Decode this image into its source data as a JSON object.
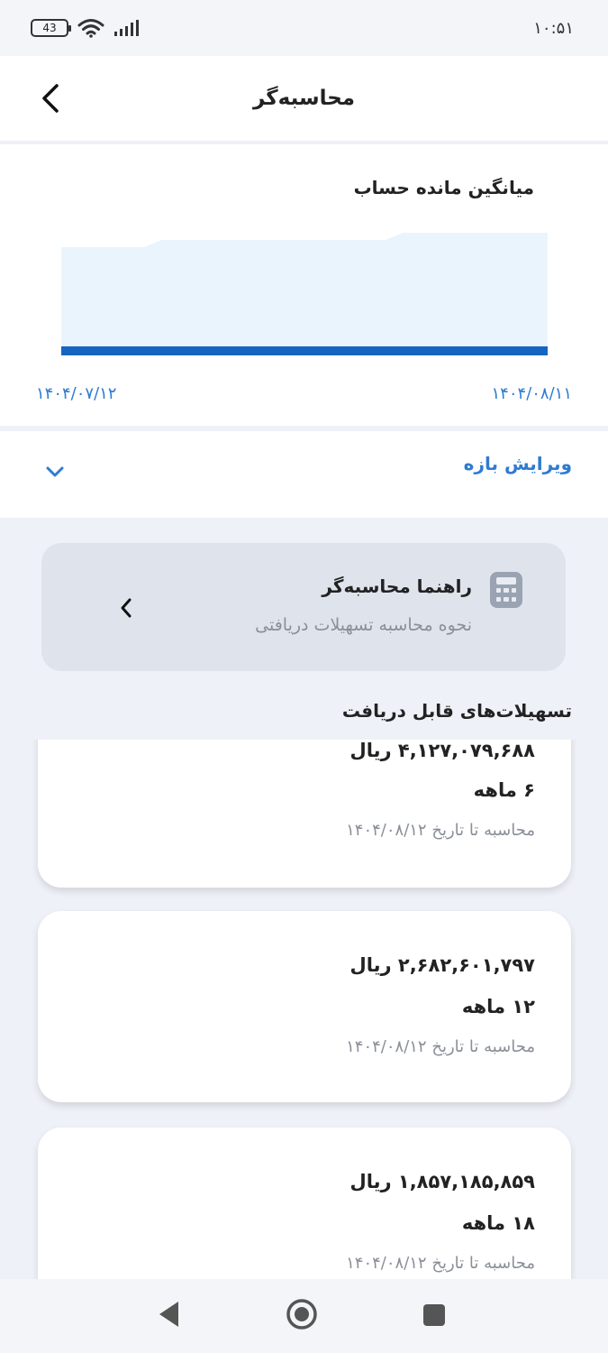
{
  "status_bar": {
    "battery": "43",
    "time": "۱۰:۵۱"
  },
  "header": {
    "title": "محاسبه‌گر"
  },
  "chart_card": {
    "title": "میانگین مانده حساب",
    "start_date": "۱۴۰۴/۰۷/۱۲",
    "end_date": "۱۴۰۴/۰۸/۱۱",
    "fill_color": "#eaf4fd",
    "line_color": "#1565c0"
  },
  "range": {
    "label": "ویرایش بازه"
  },
  "guide": {
    "title": "راهنما محاسبه‌گر",
    "subtitle": "نحوه محاسبه تسهیلات دریافتی"
  },
  "facilities": {
    "section_title": "تسهیلات‌های قابل دریافت",
    "items": [
      {
        "amount": "۴,۱۲۷,۰۷۹,۶۸۸ ریال",
        "term": "۶ ماهه",
        "date_note": "محاسبه تا تاریخ ۱۴۰۴/۰۸/۱۲"
      },
      {
        "amount": "۲,۶۸۲,۶۰۱,۷۹۷ ریال",
        "term": "۱۲ ماهه",
        "date_note": "محاسبه تا تاریخ ۱۴۰۴/۰۸/۱۲"
      },
      {
        "amount": "۱,۸۵۷,۱۸۵,۸۵۹ ریال",
        "term": "۱۸ ماهه",
        "date_note": "محاسبه تا تاریخ ۱۴۰۴/۰۸/۱۲"
      }
    ]
  },
  "nav": {
    "back_icon": "triangle-back-icon",
    "home_icon": "circle-home-icon",
    "recents_icon": "square-recents-icon"
  }
}
